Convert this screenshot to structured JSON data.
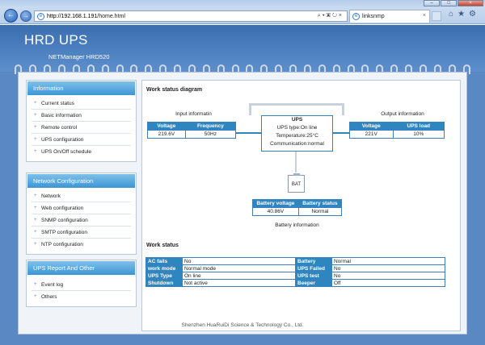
{
  "browser": {
    "url_host": "http://192.168.1.191",
    "url_path": "/home.html",
    "tab_title": "linksnmp",
    "ie_glyph": "e"
  },
  "header": {
    "title": "HRD UPS",
    "subtitle": "NETManager HRD520"
  },
  "sidebar": [
    {
      "title": "Information",
      "items": [
        "Current status",
        "Basic information",
        "Remote control",
        "UPS configuration",
        "UPS On/Off schedule"
      ]
    },
    {
      "title": "Network Configuration",
      "items": [
        "Network",
        "Web configuration",
        "SNMP configuration",
        "SMTP configuration",
        "NTP configuration"
      ]
    },
    {
      "title": "UPS Report And Other",
      "items": [
        "Event log",
        "Others"
      ]
    }
  ],
  "diagram": {
    "section_title": "Work status diagram",
    "input": {
      "caption": "Input informatin",
      "headers": [
        "Voltage",
        "Frequency"
      ],
      "values": [
        "219.6V",
        "50Hz"
      ]
    },
    "output": {
      "caption": "Output information",
      "headers": [
        "Voltage",
        "UPS load"
      ],
      "values": [
        "221V",
        "10%"
      ]
    },
    "ups": {
      "title": "UPS",
      "type": "UPS type:On line",
      "temperature": "Temperature:25°C",
      "communication": "Communication:normal"
    },
    "battery_label": "BAT",
    "battery": {
      "caption": "Battery information",
      "headers": [
        "Battery voltage",
        "Battery status"
      ],
      "values": [
        "40.86V",
        "Normal"
      ]
    }
  },
  "work_status": {
    "section_title": "Work status",
    "rows": [
      [
        {
          "k": "AC fails",
          "v": "No"
        },
        {
          "k": "Battery",
          "v": "Normal"
        }
      ],
      [
        {
          "k": "work mode",
          "v": "Normal mode"
        },
        {
          "k": "UPS Failed",
          "v": "No"
        }
      ],
      [
        {
          "k": "UPS Type",
          "v": "On line"
        },
        {
          "k": "UPS test",
          "v": "No"
        }
      ],
      [
        {
          "k": "Shutdown",
          "v": "Not active"
        },
        {
          "k": "Beeper",
          "v": "Off"
        }
      ]
    ]
  },
  "footer": "Shenzhen HuaRuiDi Science & Technology Co., Ltd.",
  "colors": {
    "accent": "#2e86c1",
    "header": "#4a7cbf"
  }
}
